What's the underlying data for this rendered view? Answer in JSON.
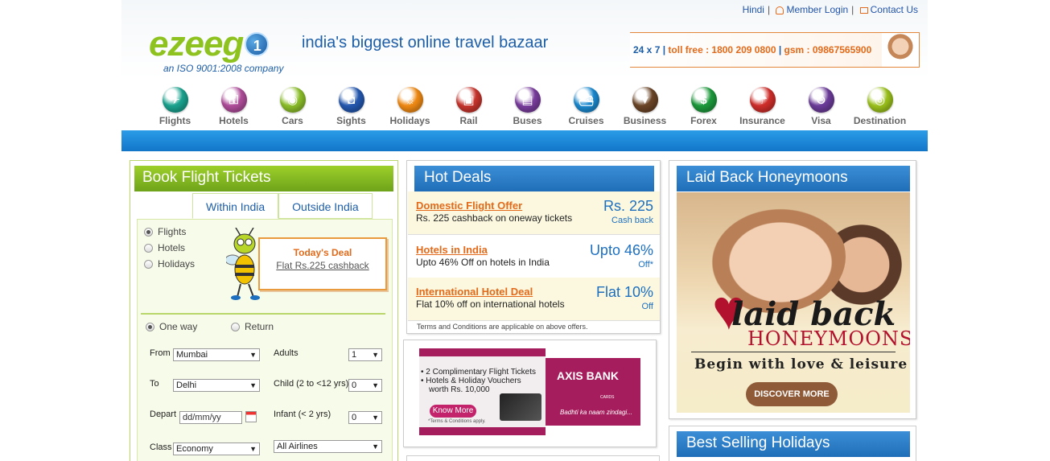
{
  "top_links": {
    "hindi": "Hindi",
    "member_login": "Member Login",
    "contact_us": "Contact Us"
  },
  "brand": {
    "logo_text": "ezeeg",
    "logo_one": "1",
    "tagline": "india's biggest online travel bazaar",
    "iso": "an ISO 9001:2008 company"
  },
  "contact": {
    "hours": "24 x 7",
    "tollfree": "toll free : 1800 209 0800",
    "gsm": "gsm : 09867565900"
  },
  "nav": [
    {
      "label": "Flights",
      "icon": "plane-icon",
      "color": "#1aa38f",
      "glyph": "✈"
    },
    {
      "label": "Hotels",
      "icon": "key-icon",
      "color": "#b04d9b",
      "glyph": "⚿"
    },
    {
      "label": "Cars",
      "icon": "car-icon",
      "color": "#8cbf2a",
      "glyph": "◉"
    },
    {
      "label": "Sights",
      "icon": "camera-icon",
      "color": "#2458b0",
      "glyph": "◘"
    },
    {
      "label": "Holidays",
      "icon": "island-icon",
      "color": "#f08a14",
      "glyph": "☼"
    },
    {
      "label": "Rail",
      "icon": "train-icon",
      "color": "#c8352d",
      "glyph": "▣"
    },
    {
      "label": "Buses",
      "icon": "bus-icon",
      "color": "#7a3d9e",
      "glyph": "▤"
    },
    {
      "label": "Cruises",
      "icon": "ship-icon",
      "color": "#1b8ad0",
      "glyph": "⛴"
    },
    {
      "label": "Business",
      "icon": "tie-icon",
      "color": "#6b4527",
      "glyph": "▼"
    },
    {
      "label": "Forex",
      "icon": "dollar-icon",
      "color": "#1d9a3c",
      "glyph": "$"
    },
    {
      "label": "Insurance",
      "icon": "umbrella-icon",
      "color": "#cf2e2a",
      "glyph": "☂"
    },
    {
      "label": "Visa",
      "icon": "globe-icon",
      "color": "#6c3c9a",
      "glyph": "⊜"
    },
    {
      "label": "Destination",
      "icon": "pin-icon",
      "color": "#9cc21c",
      "glyph": "◎"
    }
  ],
  "book": {
    "title": "Book Flight Tickets",
    "tab_within": "Within India",
    "tab_outside": "Outside India",
    "opt_flights": "Flights",
    "opt_hotels": "Hotels",
    "opt_holidays": "Holidays",
    "deal_title": "Today's Deal",
    "deal_link": "Flat Rs.225 cashback",
    "oneway": "One way",
    "return": "Return",
    "from_label": "From",
    "from_value": "Mumbai",
    "to_label": "To",
    "to_value": "Delhi",
    "depart_label": "Depart",
    "depart_placeholder": "dd/mm/yy",
    "class_label": "Class",
    "class_value": "Economy",
    "adults_label": "Adults",
    "adults_value": "1",
    "child_label": "Child (2 to <12 yrs)",
    "child_value": "0",
    "infant_label": "Infant (< 2 yrs)",
    "infant_value": "0",
    "airline_value": "All Airlines"
  },
  "hot": {
    "title": "Hot Deals",
    "deals": [
      {
        "name": "Domestic Flight Offer",
        "desc": "Rs. 225 cashback on oneway tickets",
        "big": "Rs. 225",
        "small": "Cash back"
      },
      {
        "name": "Hotels in India",
        "desc": "Upto 46% Off on hotels in India",
        "big": "Upto 46%",
        "small": "Off*"
      },
      {
        "name": "International Hotel Deal",
        "desc": "Flat 10% off on international hotels",
        "big": "Flat 10%",
        "small": "Off"
      }
    ],
    "terms": "Terms and Conditions are applicable on above offers."
  },
  "ad": {
    "point1": "• 2 Complimentary Flight Tickets",
    "point2": "• Hotels & Holiday Vouchers",
    "point3": "worth Rs. 10,000",
    "know_more": "Know More",
    "tc": "*Terms & Conditions apply.",
    "bank": "AXIS BANK",
    "cards": "CARDS",
    "tagline": "Badhti ka naam zindagi..."
  },
  "honey": {
    "title": "Laid Back Honeymoons",
    "laid": "laid back",
    "honeymoons": "HONEYMOONS",
    "sub": "Begin with love & leisure",
    "cta": "DISCOVER MORE"
  },
  "best": {
    "title": "Best Selling Holidays"
  }
}
